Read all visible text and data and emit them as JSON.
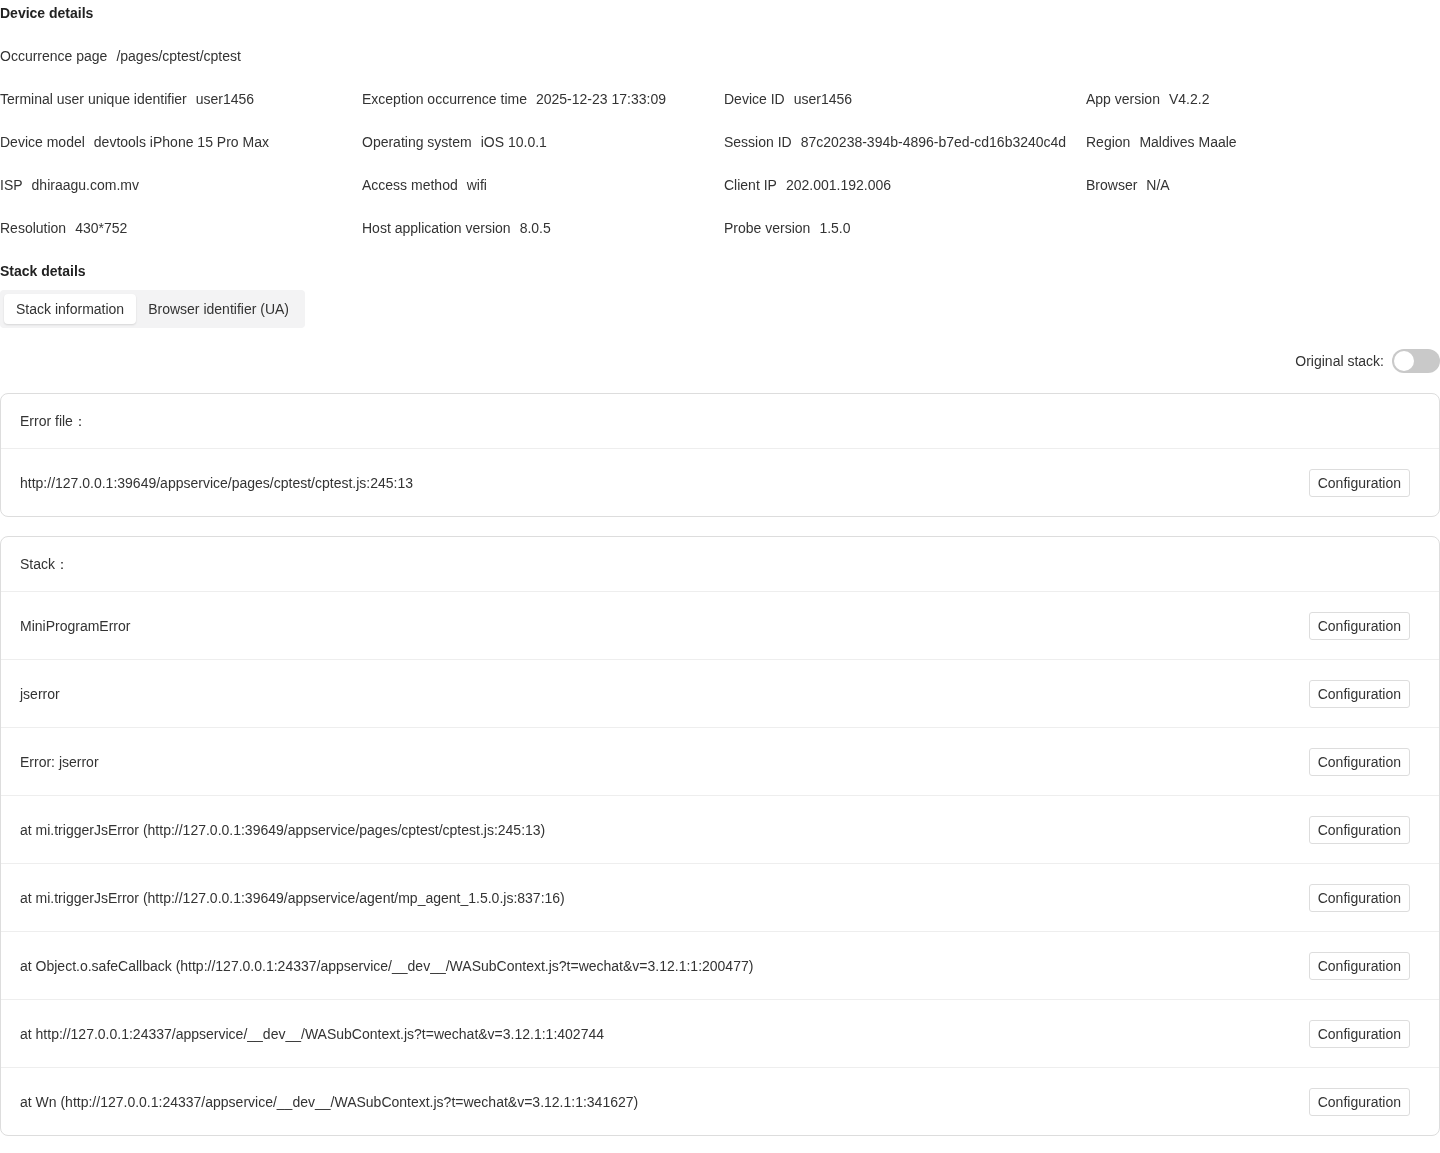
{
  "device_details": {
    "title": "Device details",
    "rows": [
      [
        {
          "label": "Occurrence page",
          "value": "/pages/cptest/cptest"
        }
      ],
      [
        {
          "label": "Terminal user unique identifier",
          "value": "user1456"
        },
        {
          "label": "Exception occurrence time",
          "value": "2025-12-23 17:33:09"
        },
        {
          "label": "Device ID",
          "value": "user1456"
        },
        {
          "label": "App version",
          "value": "V4.2.2"
        }
      ],
      [
        {
          "label": "Device model",
          "value": "devtools iPhone 15 Pro Max"
        },
        {
          "label": "Operating system",
          "value": "iOS 10.0.1"
        },
        {
          "label": "Session ID",
          "value": "87c20238-394b-4896-b7ed-cd16b3240c4d"
        },
        {
          "label": "Region",
          "value": "Maldives Maale"
        }
      ],
      [
        {
          "label": "ISP",
          "value": "dhiraagu.com.mv"
        },
        {
          "label": "Access method",
          "value": "wifi"
        },
        {
          "label": "Client IP",
          "value": "202.001.192.006"
        },
        {
          "label": "Browser",
          "value": "N/A"
        }
      ],
      [
        {
          "label": "Resolution",
          "value": "430*752"
        },
        {
          "label": "Host application version",
          "value": "8.0.5"
        },
        {
          "label": "Probe version",
          "value": "1.5.0"
        }
      ]
    ]
  },
  "stack_details": {
    "title": "Stack details",
    "tabs": [
      {
        "label": "Stack information",
        "selected": true
      },
      {
        "label": "Browser identifier (UA)",
        "selected": false
      }
    ],
    "original_stack": {
      "label": "Original stack:",
      "on": false
    },
    "error_file": {
      "title": "Error file：",
      "rows": [
        {
          "text": "http://127.0.0.1:39649/appservice/pages/cptest/cptest.js:245:13",
          "button": "Configuration"
        }
      ]
    },
    "stack": {
      "title": "Stack：",
      "rows": [
        {
          "text": "MiniProgramError",
          "button": "Configuration"
        },
        {
          "text": "jserror",
          "button": "Configuration"
        },
        {
          "text": "Error: jserror",
          "button": "Configuration"
        },
        {
          "text": "at mi.triggerJsError (http://127.0.0.1:39649/appservice/pages/cptest/cptest.js:245:13)",
          "button": "Configuration"
        },
        {
          "text": "at mi.triggerJsError (http://127.0.0.1:39649/appservice/agent/mp_agent_1.5.0.js:837:16)",
          "button": "Configuration"
        },
        {
          "text": "at Object.o.safeCallback (http://127.0.0.1:24337/appservice/__dev__/WASubContext.js?t=wechat&v=3.12.1:1:200477)",
          "button": "Configuration"
        },
        {
          "text": "at http://127.0.0.1:24337/appservice/__dev__/WASubContext.js?t=wechat&v=3.12.1:1:402744",
          "button": "Configuration"
        },
        {
          "text": "at Wn (http://127.0.0.1:24337/appservice/__dev__/WASubContext.js?t=wechat&v=3.12.1:1:341627)",
          "button": "Configuration"
        }
      ]
    }
  }
}
